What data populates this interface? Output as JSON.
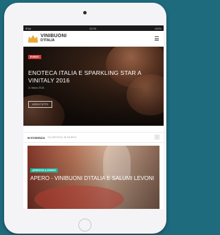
{
  "status_bar": {
    "left": "iPad",
    "center": "12:00",
    "right": "100%"
  },
  "brand": {
    "line1": "VINIBUONI",
    "line2": "D'ITALIA"
  },
  "hero": {
    "badge": "EVENTI",
    "title": "ENOTECA ITALIA E SPARKLING STAR A VINITALY 2016",
    "meta": "11 Marzo 2016",
    "button": "LEGGI TUTTO"
  },
  "infocus": {
    "label": "IN EVIDENZA",
    "sub": "GLI ARTICOLI IN RILIEVO",
    "arrow": "›"
  },
  "card": {
    "badge": "APERITIVI & EVENTI",
    "title": "APERO - VINIBUONI D'ITALIA E SALUMI LEVONI"
  },
  "colors": {
    "background": "#1f6b7e",
    "device": "#f4f4f6",
    "badge_red": "#d43a3a",
    "badge_teal": "#27b3a0",
    "crown": "#e8a93a"
  }
}
